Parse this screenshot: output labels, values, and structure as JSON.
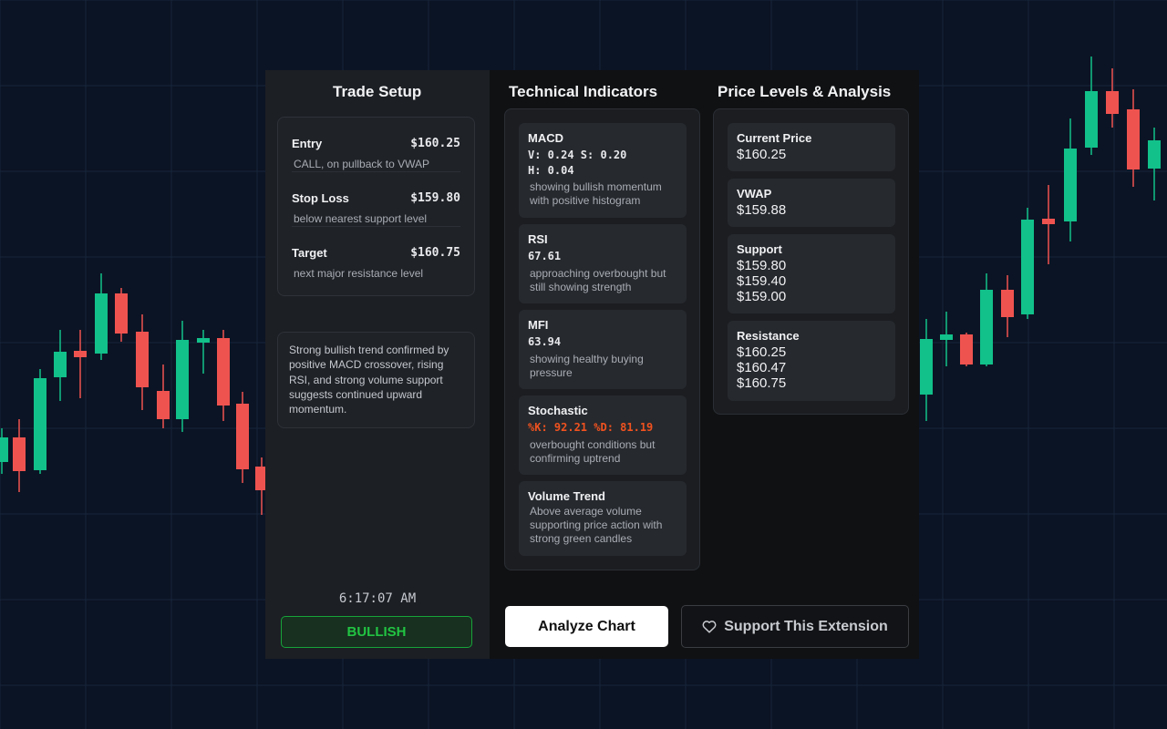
{
  "colors": {
    "bull": "#12c18a",
    "bear": "#ef5350",
    "background": "#0b1424",
    "sentiment": "#22c443",
    "warn": "#f0521f"
  },
  "trade_setup": {
    "title": "Trade Setup",
    "rows": [
      {
        "label": "Entry",
        "value": "$160.25",
        "desc": "CALL, on pullback to VWAP"
      },
      {
        "label": "Stop Loss",
        "value": "$159.80",
        "desc": "below nearest support level"
      },
      {
        "label": "Target",
        "value": "$160.75",
        "desc": "next major resistance level"
      }
    ],
    "summary": "Strong bullish trend confirmed by positive MACD crossover, rising RSI, and strong volume support suggests continued upward momentum.",
    "time": "6:17:07 AM",
    "sentiment": "BULLISH"
  },
  "indicators": {
    "title": "Technical Indicators",
    "items": [
      {
        "name": "MACD",
        "value_line1": "V: 0.24 S: 0.20",
        "value_line2": "H: 0.04",
        "note": "showing bullish momentum with positive histogram"
      },
      {
        "name": "RSI",
        "value_line1": "67.61",
        "note": "approaching overbought but still showing strength"
      },
      {
        "name": "MFI",
        "value_line1": "63.94",
        "note": "showing healthy buying pressure"
      },
      {
        "name": "Stochastic",
        "value_line1": "%K: 92.21 %D: 81.19",
        "note": "overbought conditions but confirming uptrend"
      },
      {
        "name": "Volume Trend",
        "note": "Above average volume supporting price action with strong green candles"
      }
    ]
  },
  "levels": {
    "title": "Price Levels & Analysis",
    "current": {
      "label": "Current Price",
      "price": "$160.25"
    },
    "vwap": {
      "label": "VWAP",
      "price": "$159.88"
    },
    "support": {
      "label": "Support",
      "prices": [
        "$159.80",
        "$159.40",
        "$159.00"
      ]
    },
    "resistance": {
      "label": "Resistance",
      "prices": [
        "$160.25",
        "$160.47",
        "$160.75"
      ]
    }
  },
  "buttons": {
    "analyze": "Analyze Chart",
    "support": "Support This Extension"
  }
}
